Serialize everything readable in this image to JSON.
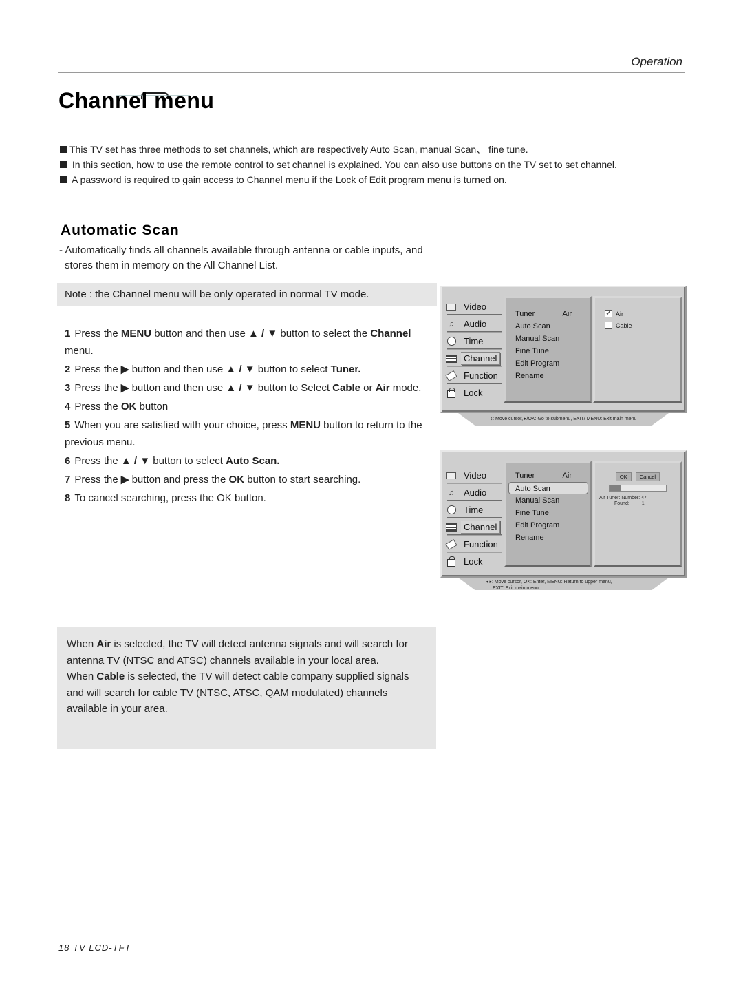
{
  "header": {
    "section_label": "Operation"
  },
  "page_title": "Channel menu",
  "intro": {
    "paragraphs": [
      "This TV set has three methods to set channels, which are respectively Auto Scan,  manual Scan、 fine tune.",
      " In this section, how to use the remote control  to set channel is explained. You can also use buttons on the TV set to set channel.",
      " A password is required to gain access to Channel menu if the Lock of Edit program menu is turned on."
    ]
  },
  "automatic_scan": {
    "title": "Automatic Scan",
    "desc_line1": "- Automatically finds all channels available through antenna or cable inputs, and",
    "desc_line2": "stores them in memory on the All Channel List.",
    "note": "Note : the Channel menu will be only operated  in normal TV mode."
  },
  "steps": [
    {
      "num": "1",
      "parts": [
        [
          "t",
          "Press the "
        ],
        [
          "b",
          "MENU"
        ],
        [
          "t",
          " button and then use "
        ],
        [
          "b",
          "▲ / ▼"
        ],
        [
          "t",
          " button to select the "
        ],
        [
          "b",
          "Channel"
        ],
        [
          "t",
          " menu."
        ]
      ]
    },
    {
      "num": "2",
      "parts": [
        [
          "t",
          "Press the "
        ],
        [
          "b",
          "▶"
        ],
        [
          "t",
          " button and then use "
        ],
        [
          "b",
          "▲ / ▼"
        ],
        [
          "t",
          " button to select "
        ],
        [
          "b",
          "Tuner."
        ]
      ]
    },
    {
      "num": "3",
      "parts": [
        [
          "t",
          "Press the "
        ],
        [
          "b",
          "▶"
        ],
        [
          "t",
          " button and then use "
        ],
        [
          "b",
          "▲ / ▼"
        ],
        [
          "t",
          " button to Select "
        ],
        [
          "b",
          "Cable"
        ],
        [
          "t",
          " or "
        ],
        [
          "b",
          "Air"
        ],
        [
          "t",
          "  mode."
        ]
      ]
    },
    {
      "num": "4",
      "parts": [
        [
          "t",
          "Press the "
        ],
        [
          "b",
          "OK"
        ],
        [
          "t",
          " button"
        ]
      ]
    },
    {
      "num": "5",
      "parts": [
        [
          "t",
          "When you are satisfied with your choice,  press "
        ],
        [
          "b",
          "MENU"
        ],
        [
          "t",
          " button to return to the previous menu."
        ]
      ]
    },
    {
      "num": "6",
      "parts": [
        [
          "t",
          "Press the  "
        ],
        [
          "b",
          "▲ / ▼"
        ],
        [
          "t",
          " button to select "
        ],
        [
          "b",
          "Auto Scan."
        ]
      ]
    },
    {
      "num": "7",
      "parts": [
        [
          "t",
          "Press the "
        ],
        [
          "b",
          "▶"
        ],
        [
          "t",
          " button and press the "
        ],
        [
          "b",
          "OK"
        ],
        [
          "t",
          " button to start searching."
        ]
      ]
    },
    {
      "num": "8",
      "parts": [
        [
          "t",
          "To cancel searching, press the OK button."
        ]
      ]
    }
  ],
  "info_box": {
    "parts": [
      [
        "t",
        "When "
      ],
      [
        "b",
        "Air"
      ],
      [
        "t",
        " is selected, the TV will detect antenna signals and will search for antenna TV (NTSC and ATSC) channels available in your local area."
      ],
      [
        "br",
        ""
      ],
      [
        "t",
        "When "
      ],
      [
        "b",
        "Cable"
      ],
      [
        "t",
        " is selected, the TV will detect cable company supplied signals and will search for cable TV (NTSC, ATSC, QAM modulated) channels available in your area."
      ]
    ]
  },
  "tv_menu_1": {
    "sidebar": [
      {
        "label": "Video",
        "icon": "monitor-icon"
      },
      {
        "label": "Audio",
        "icon": "music-note-icon"
      },
      {
        "label": "Time",
        "icon": "clock-icon"
      },
      {
        "label": "Channel",
        "icon": "channel-list-icon",
        "active": true
      },
      {
        "label": "Function",
        "icon": "tag-icon"
      },
      {
        "label": "Lock",
        "icon": "lock-icon"
      }
    ],
    "submenu": [
      {
        "label": "Tuner",
        "value": "Air"
      },
      {
        "label": "Auto Scan"
      },
      {
        "label": "Manual Scan"
      },
      {
        "label": "Fine Tune"
      },
      {
        "label": "Edit Program"
      },
      {
        "label": "Rename"
      }
    ],
    "options": [
      {
        "label": "Air",
        "checked": true,
        "mark": "✓"
      },
      {
        "label": "Cable",
        "checked": false,
        "mark": ""
      }
    ],
    "help": "↕: Move cursor,  ▸/OK: Go to submenu, EXIT/ MENU: Exit main menu"
  },
  "tv_menu_2": {
    "sidebar": [
      {
        "label": "Video",
        "icon": "monitor-icon"
      },
      {
        "label": "Audio",
        "icon": "music-note-icon"
      },
      {
        "label": "Time",
        "icon": "clock-icon"
      },
      {
        "label": "Channel",
        "icon": "channel-list-icon",
        "active": true
      },
      {
        "label": "Function",
        "icon": "tag-icon"
      },
      {
        "label": "Lock",
        "icon": "lock-icon"
      }
    ],
    "submenu": [
      {
        "label": "Tuner",
        "value": "Air"
      },
      {
        "label": "Auto Scan",
        "selected": true
      },
      {
        "label": "Manual Scan"
      },
      {
        "label": "Fine Tune"
      },
      {
        "label": "Edit Program"
      },
      {
        "label": "Rename"
      }
    ],
    "scan": {
      "ok_label": "OK",
      "cancel_label": "Cancel",
      "progress_percent": 20,
      "tuner_label": "Air Tuner:",
      "number_label": "Number:",
      "number_value": "47",
      "found_label": "Found:",
      "found_value": "1"
    },
    "help_line1": "◂ ▸: Move cursor,   OK: Enter, MENU: Return to upper menu,",
    "help_line2": "EXIT: Exit main menu"
  },
  "footer": {
    "page_label": "18  TV LCD-TFT"
  }
}
